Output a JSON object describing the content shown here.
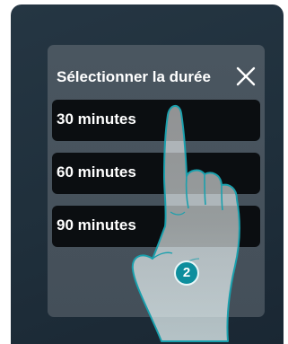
{
  "dialog": {
    "title": "Sélectionner la durée",
    "options": [
      {
        "label": "30 minutes"
      },
      {
        "label": "60 minutes"
      },
      {
        "label": "90 minutes"
      }
    ]
  },
  "annotation": {
    "step_number": "2"
  },
  "colors": {
    "background": "#1f2f3b",
    "dialog": "#47525c",
    "option": "#0b0e11",
    "badge": "#0d8e9d"
  },
  "icons": [
    "close-icon",
    "pointing-hand-icon"
  ]
}
